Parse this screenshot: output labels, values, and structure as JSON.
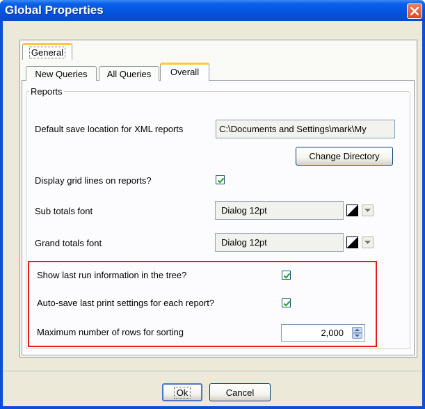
{
  "window": {
    "title": "Global Properties"
  },
  "outer_tabs": [
    {
      "label": "General",
      "active": true
    }
  ],
  "inner_tabs": [
    {
      "label": "New Queries",
      "active": false
    },
    {
      "label": "All Queries",
      "active": false
    },
    {
      "label": "Overall",
      "active": true
    }
  ],
  "reports_group": {
    "title": "Reports",
    "xml_location": {
      "label": "Default save location for XML reports",
      "value": "C:\\Documents and Settings\\mark\\My"
    },
    "change_directory_label": "Change Directory",
    "grid_lines": {
      "label": "Display grid lines on reports?",
      "checked": true
    },
    "sub_totals": {
      "label": "Sub totals font",
      "value": "Dialog 12pt"
    },
    "grand_totals": {
      "label": "Grand totals font",
      "value": "Dialog 12pt"
    },
    "last_run": {
      "label": "Show last run information in the tree?",
      "checked": true
    },
    "auto_save": {
      "label": "Auto-save last print settings for each report?",
      "checked": true
    },
    "max_rows": {
      "label": "Maximum number of rows for sorting",
      "value": "2,000"
    }
  },
  "buttons": {
    "ok": "Ok",
    "cancel": "Cancel"
  },
  "colors": {
    "titlebar": "#0554df",
    "dialog_bg": "#ece9d8",
    "highlight_border": "#e21b1b",
    "check": "#21a121",
    "active_tab_accent": "#ffc83c"
  }
}
